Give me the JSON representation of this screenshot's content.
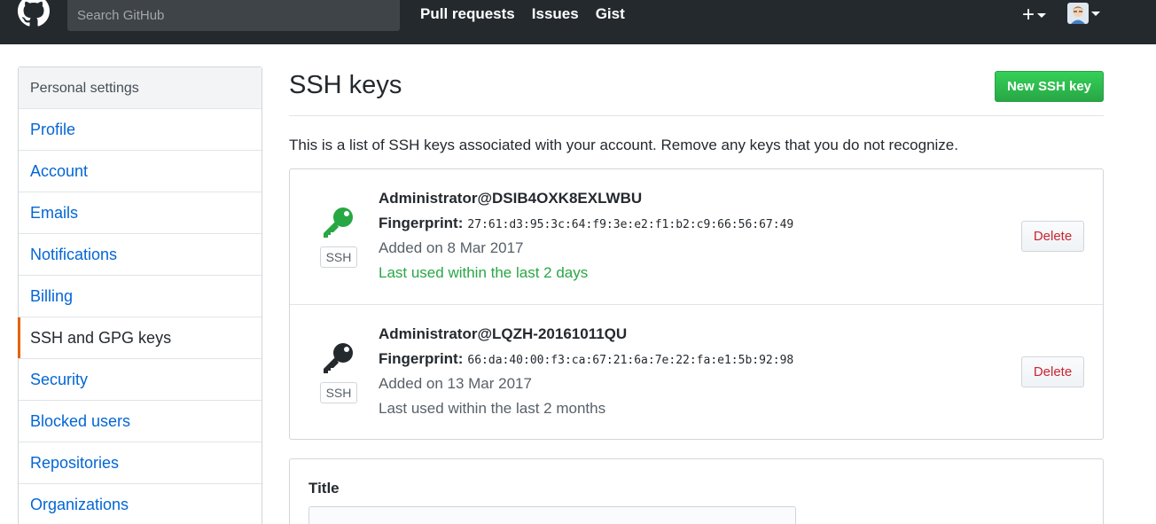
{
  "header": {
    "search_placeholder": "Search GitHub",
    "nav": [
      "Pull requests",
      "Issues",
      "Gist"
    ],
    "plus_icon": "plus-icon",
    "logo_icon": "github-mark-icon",
    "bg_color": "#24292e"
  },
  "sidebar": {
    "heading": "Personal settings",
    "items": [
      {
        "label": "Profile"
      },
      {
        "label": "Account"
      },
      {
        "label": "Emails"
      },
      {
        "label": "Notifications"
      },
      {
        "label": "Billing"
      },
      {
        "label": "SSH and GPG keys",
        "active": true
      },
      {
        "label": "Security"
      },
      {
        "label": "Blocked users"
      },
      {
        "label": "Repositories"
      },
      {
        "label": "Organizations"
      }
    ],
    "active_accent": "#e36209"
  },
  "main": {
    "title": "SSH keys",
    "new_button": "New SSH key",
    "description": "This is a list of SSH keys associated with your account. Remove any keys that you do not recognize.",
    "keys": [
      {
        "name": "Administrator@DSIB4OXK8EXLWBU",
        "fingerprint_label": "Fingerprint:",
        "fingerprint": "27:61:d3:95:3c:64:f9:3e:e2:f1:b2:c9:66:56:67:49",
        "added": "Added on 8 Mar 2017",
        "last_used": "Last used within the last 2 days",
        "badge": "SSH",
        "icon_color": "#28a745",
        "delete_label": "Delete"
      },
      {
        "name": "Administrator@LQZH-20161011QU",
        "fingerprint_label": "Fingerprint:",
        "fingerprint": "66:da:40:00:f3:ca:67:21:6a:7e:22:fa:e1:5b:92:98",
        "added": "Added on 13 Mar 2017",
        "last_used": "Last used within the last 2 months",
        "badge": "SSH",
        "icon_color": "#24292e",
        "delete_label": "Delete"
      }
    ],
    "form": {
      "title_label": "Title",
      "title_value": ""
    }
  }
}
